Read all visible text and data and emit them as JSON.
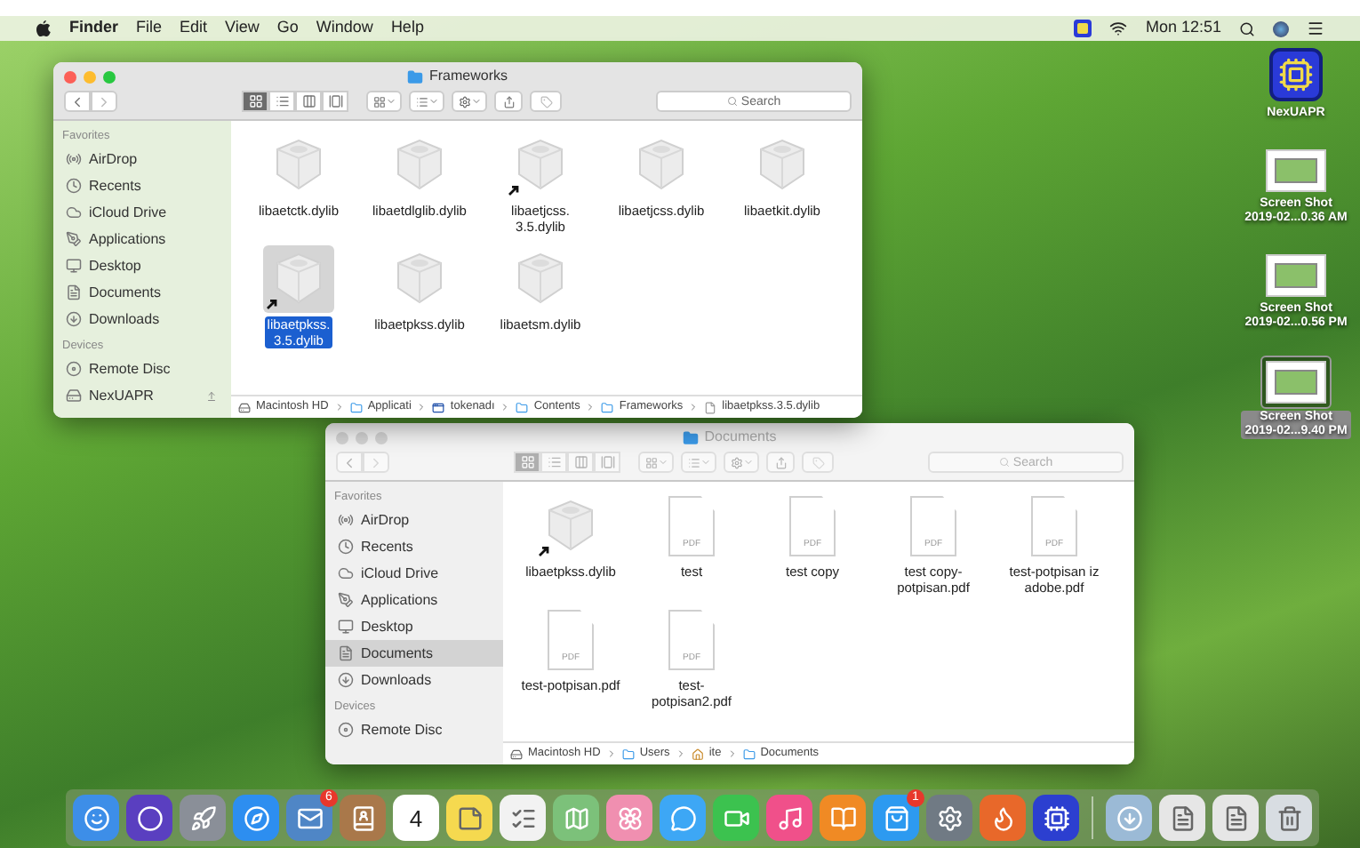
{
  "menu_bar": {
    "app_name": "Finder",
    "menus": [
      "File",
      "Edit",
      "View",
      "Go",
      "Window",
      "Help"
    ],
    "clock": "Mon 12:51"
  },
  "windows": [
    {
      "title": "Frameworks",
      "active": true,
      "views": [
        {
          "kind": "icons",
          "selected": true
        },
        {
          "kind": "list",
          "selected": false
        },
        {
          "kind": "columns",
          "selected": false
        },
        {
          "kind": "gallery",
          "selected": false
        }
      ],
      "search": {
        "placeholder": "Search"
      },
      "sidebar": [
        {
          "heading": "Favorites",
          "items": [
            {
              "label": "AirDrop",
              "kind": "airdrop",
              "selected": false
            },
            {
              "label": "Recents",
              "kind": "recents",
              "selected": false
            },
            {
              "label": "iCloud Drive",
              "kind": "cloud",
              "selected": false
            },
            {
              "label": "Applications",
              "kind": "apps",
              "selected": false
            },
            {
              "label": "Desktop",
              "kind": "desktop",
              "selected": false
            },
            {
              "label": "Documents",
              "kind": "documents",
              "selected": false
            },
            {
              "label": "Downloads",
              "kind": "downloads",
              "selected": false
            }
          ]
        },
        {
          "heading": "Devices",
          "items": [
            {
              "label": "Remote Disc",
              "kind": "disc",
              "selected": false
            },
            {
              "label": "NexUAPR",
              "kind": "drive",
              "selected": false,
              "eject": true
            }
          ]
        }
      ],
      "files": [
        {
          "lines": [
            "libaetctk.dylib"
          ],
          "kind": "dylib",
          "alias": false,
          "selected": false
        },
        {
          "lines": [
            "libaetdlglib.dylib"
          ],
          "kind": "dylib",
          "alias": false,
          "selected": false
        },
        {
          "lines": [
            "libaetjcss.",
            "3.5.dylib"
          ],
          "kind": "dylib",
          "alias": true,
          "selected": false
        },
        {
          "lines": [
            "libaetjcss.dylib"
          ],
          "kind": "dylib",
          "alias": false,
          "selected": false
        },
        {
          "lines": [
            "libaetkit.dylib"
          ],
          "kind": "dylib",
          "alias": false,
          "selected": false
        },
        {
          "lines": [
            "libaetpkss.",
            "3.5.dylib"
          ],
          "kind": "dylib",
          "alias": true,
          "selected": true
        },
        {
          "lines": [
            "libaetpkss.dylib"
          ],
          "kind": "dylib",
          "alias": false,
          "selected": false
        },
        {
          "lines": [
            "libaetsm.dylib"
          ],
          "kind": "dylib",
          "alias": false,
          "selected": false
        }
      ],
      "path": [
        {
          "label": "Macintosh HD",
          "kind": "drive"
        },
        {
          "label": "Applicati",
          "kind": "folder"
        },
        {
          "label": "tokenadı",
          "kind": "app"
        },
        {
          "label": "Contents",
          "kind": "folder"
        },
        {
          "label": "Frameworks",
          "kind": "folder"
        },
        {
          "label": "libaetpkss.3.5.dylib",
          "kind": "file"
        }
      ]
    },
    {
      "title": "Documents",
      "active": false,
      "views": [
        {
          "kind": "icons",
          "selected": true
        },
        {
          "kind": "list",
          "selected": false
        },
        {
          "kind": "columns",
          "selected": false
        },
        {
          "kind": "gallery",
          "selected": false
        }
      ],
      "search": {
        "placeholder": "Search"
      },
      "sidebar": [
        {
          "heading": "Favorites",
          "items": [
            {
              "label": "AirDrop",
              "kind": "airdrop",
              "selected": false
            },
            {
              "label": "Recents",
              "kind": "recents",
              "selected": false
            },
            {
              "label": "iCloud Drive",
              "kind": "cloud",
              "selected": false
            },
            {
              "label": "Applications",
              "kind": "apps",
              "selected": false
            },
            {
              "label": "Desktop",
              "kind": "desktop",
              "selected": false
            },
            {
              "label": "Documents",
              "kind": "documents",
              "selected": true
            },
            {
              "label": "Downloads",
              "kind": "downloads",
              "selected": false
            }
          ]
        },
        {
          "heading": "Devices",
          "items": [
            {
              "label": "Remote Disc",
              "kind": "disc",
              "selected": false
            }
          ]
        }
      ],
      "files": [
        {
          "lines": [
            "libaetpkss.dylib"
          ],
          "kind": "dylib",
          "alias": true,
          "selected": false
        },
        {
          "lines": [
            "test"
          ],
          "kind": "pdf",
          "badge": "PDF",
          "alias": false,
          "selected": false
        },
        {
          "lines": [
            "test copy"
          ],
          "kind": "pdf",
          "badge": "PDF",
          "alias": false,
          "selected": false
        },
        {
          "lines": [
            "test copy-",
            "potpisan.pdf"
          ],
          "kind": "pdf",
          "badge": "PDF",
          "alias": false,
          "selected": false
        },
        {
          "lines": [
            "test-potpisan iz",
            "adobe.pdf"
          ],
          "kind": "pdf",
          "badge": "PDF",
          "alias": false,
          "selected": false
        },
        {
          "lines": [
            "test-potpisan.pdf"
          ],
          "kind": "pdf",
          "badge": "PDF",
          "alias": false,
          "selected": false
        },
        {
          "lines": [
            "test-",
            "potpisan2.pdf"
          ],
          "kind": "pdf",
          "badge": "PDF",
          "alias": false,
          "selected": false
        }
      ],
      "path": [
        {
          "label": "Macintosh HD",
          "kind": "drive"
        },
        {
          "label": "Users",
          "kind": "folder"
        },
        {
          "label": "ite",
          "kind": "home"
        },
        {
          "label": "Documents",
          "kind": "folder"
        }
      ]
    }
  ],
  "desktop_icons": [
    {
      "lines": [
        "NexUAPR"
      ],
      "kind": "chip",
      "selected": false
    },
    {
      "lines": [
        "Screen Shot",
        "2019-02...0.36 AM"
      ],
      "kind": "screenshot",
      "selected": false
    },
    {
      "lines": [
        "Screen Shot",
        "2019-02...0.56 PM"
      ],
      "kind": "screenshot",
      "selected": false
    },
    {
      "lines": [
        "Screen Shot",
        "2019-02...9.40 PM"
      ],
      "kind": "screenshot",
      "selected": true
    }
  ],
  "dock": [
    {
      "kind": "finder"
    },
    {
      "kind": "siri"
    },
    {
      "kind": "launchpad"
    },
    {
      "kind": "safari"
    },
    {
      "kind": "mail",
      "badge": "6"
    },
    {
      "kind": "contacts"
    },
    {
      "kind": "calendar",
      "text": "4"
    },
    {
      "kind": "notes"
    },
    {
      "kind": "reminders"
    },
    {
      "kind": "maps"
    },
    {
      "kind": "photos"
    },
    {
      "kind": "messages"
    },
    {
      "kind": "facetime"
    },
    {
      "kind": "music"
    },
    {
      "kind": "books"
    },
    {
      "kind": "appstore",
      "badge": "1"
    },
    {
      "kind": "settings"
    },
    {
      "kind": "firefox"
    },
    {
      "kind": "chip"
    },
    {
      "kind": "separator"
    },
    {
      "kind": "downloads"
    },
    {
      "kind": "document"
    },
    {
      "kind": "document"
    },
    {
      "kind": "trash"
    }
  ]
}
